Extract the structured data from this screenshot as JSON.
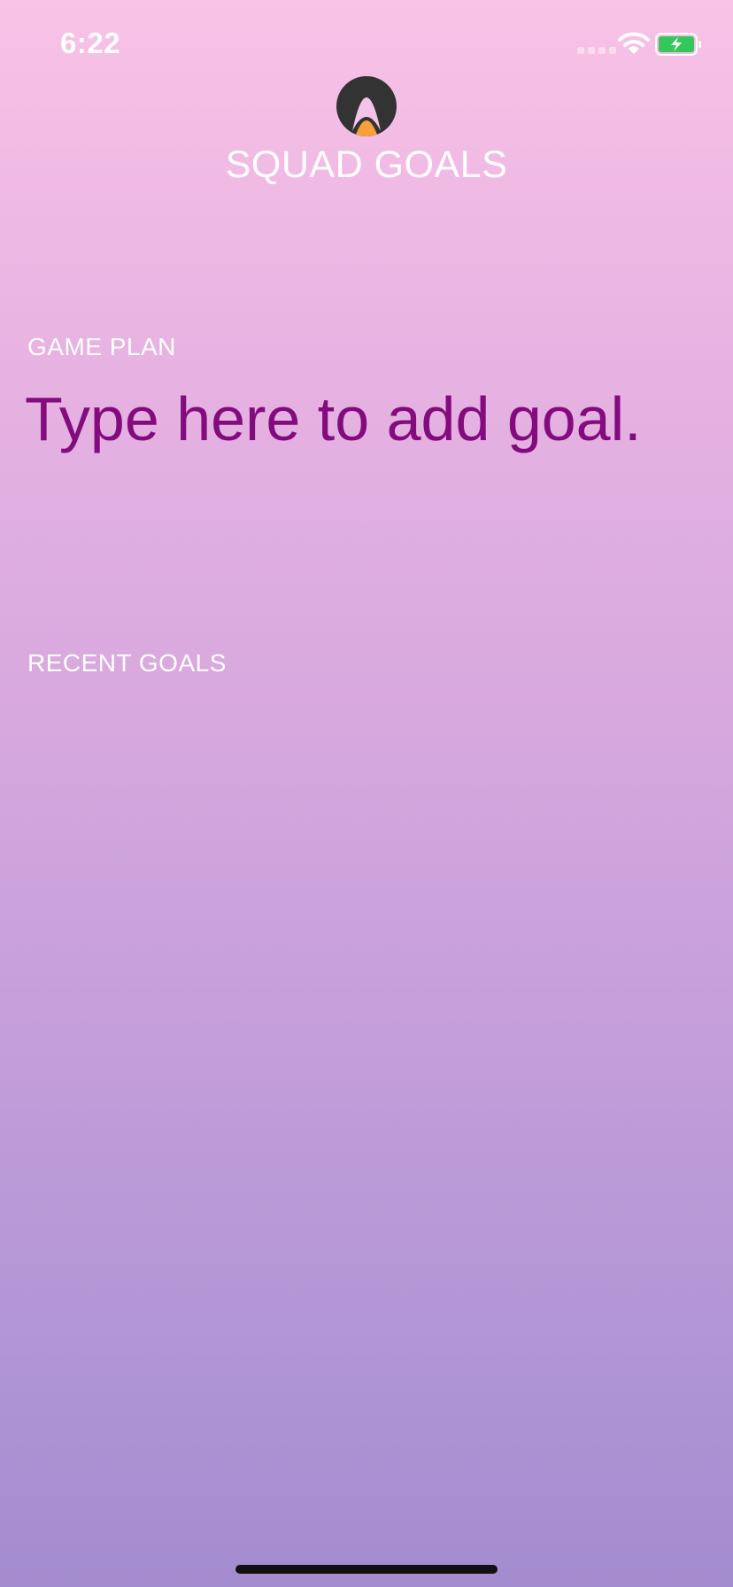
{
  "status_bar": {
    "time": "6:22",
    "icons": [
      "signal-icon",
      "wifi-icon",
      "battery-charging-icon"
    ]
  },
  "header": {
    "logo": "app-logo-icon",
    "title": "SQUAD GOALS"
  },
  "game_plan": {
    "label": "GAME PLAN",
    "input_value": "",
    "placeholder": "Type here to add goal."
  },
  "recent_goals": {
    "label": "RECENT GOALS",
    "items": []
  },
  "colors": {
    "gradient_top": "#F9C2E6",
    "gradient_bottom": "#A38CCF",
    "goal_text": "#830B7E",
    "battery_green": "#35C759",
    "logo_dark": "#333333",
    "logo_accent": "#F6A03C"
  }
}
